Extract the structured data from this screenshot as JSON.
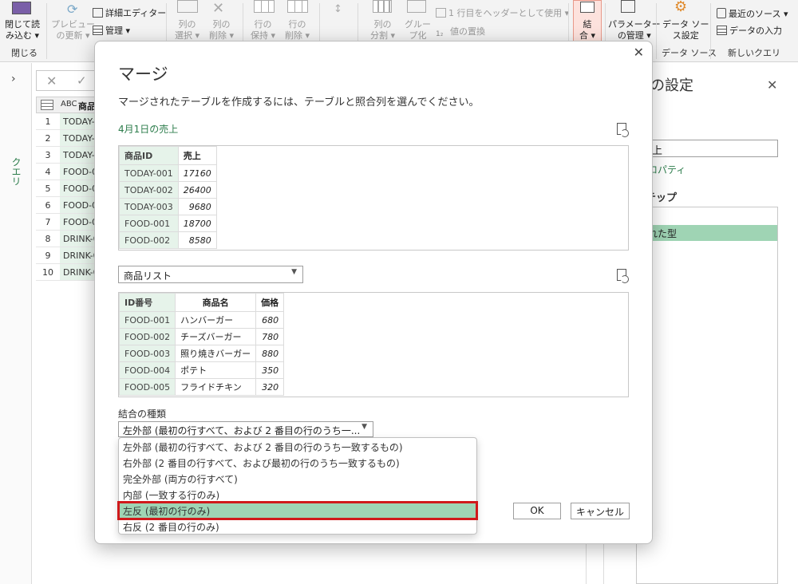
{
  "ribbon": {
    "close_load": [
      "閉じて読",
      "み込む ▾"
    ],
    "close_group": "閉じる",
    "preview_refresh": [
      "プレビュー",
      "の更新 ▾"
    ],
    "advanced_editor": "詳細エディター",
    "manage": "管理 ▾",
    "choose_columns": [
      "列の",
      "選択 ▾"
    ],
    "remove_columns": [
      "列の",
      "削除 ▾"
    ],
    "keep_rows": [
      "行の",
      "保持 ▾"
    ],
    "remove_rows": [
      "行の",
      "削除 ▾"
    ],
    "split_column": [
      "列の",
      "分割 ▾"
    ],
    "group_by": [
      "グルー",
      "プ化"
    ],
    "use_first_row": "1 行目をヘッダーとして使用 ▾",
    "replace_values": "値の置換",
    "merge": [
      "結",
      "合 ▾"
    ],
    "manage_params": [
      "パラメーター",
      "の管理 ▾"
    ],
    "data_source_settings": [
      "データ ソー",
      "ス設定"
    ],
    "data_source_group": "データ ソース",
    "recent_sources": "最近のソース ▾",
    "enter_data": "データの入力",
    "new_query_group": "新しいクエリ"
  },
  "leftpane": {
    "queries_label": "クエリ"
  },
  "grid": {
    "column_header": "商品",
    "type_icon": "ABC",
    "rows": [
      {
        "n": "1",
        "v": "TODAY-0"
      },
      {
        "n": "2",
        "v": "TODAY-0"
      },
      {
        "n": "3",
        "v": "TODAY-0"
      },
      {
        "n": "4",
        "v": "FOOD-0"
      },
      {
        "n": "5",
        "v": "FOOD-0"
      },
      {
        "n": "6",
        "v": "FOOD-0"
      },
      {
        "n": "7",
        "v": "FOOD-0"
      },
      {
        "n": "8",
        "v": "DRINK-0"
      },
      {
        "n": "9",
        "v": "DRINK-0"
      },
      {
        "n": "10",
        "v": "DRINK-0"
      }
    ]
  },
  "rightpane": {
    "title": "の設定",
    "name_value": "売上",
    "all_properties": "ロパティ",
    "applied_steps": "テップ",
    "selected_step": "れた型"
  },
  "dialog": {
    "title": "マージ",
    "description": "マージされたテーブルを作成するには、テーブルと照合列を選んでください。",
    "first_table_name": "4月1日の売上",
    "table1": {
      "headers": [
        "商品ID",
        "売上"
      ],
      "rows": [
        [
          "TODAY-001",
          "17160"
        ],
        [
          "TODAY-002",
          "26400"
        ],
        [
          "TODAY-003",
          "9680"
        ],
        [
          "FOOD-001",
          "18700"
        ],
        [
          "FOOD-002",
          "8580"
        ]
      ]
    },
    "second_table_select": "商品リスト",
    "table2": {
      "headers": [
        "ID番号",
        "商品名",
        "価格"
      ],
      "rows": [
        [
          "FOOD-001",
          "ハンバーガー",
          "680"
        ],
        [
          "FOOD-002",
          "チーズバーガー",
          "780"
        ],
        [
          "FOOD-003",
          "照り焼きバーガー",
          "880"
        ],
        [
          "FOOD-004",
          "ポテト",
          "350"
        ],
        [
          "FOOD-005",
          "フライドチキン",
          "320"
        ]
      ]
    },
    "join_kind_label": "結合の種類",
    "join_kind_selected": "左外部 (最初の行すべて、および 2 番目の行のうち一...",
    "join_options": [
      "左外部 (最初の行すべて、および 2 番目の行のうち一致するもの)",
      "右外部 (2 番目の行すべて、および最初の行のうち一致するもの)",
      "完全外部 (両方の行すべて)",
      "内部 (一致する行のみ)",
      "左反 (最初の行のみ)",
      "右反 (2 番目の行のみ)"
    ],
    "highlighted_option_index": 4,
    "ok_label": "OK",
    "cancel_label": "キャンセル"
  },
  "colors": {
    "accent_green": "#2d7d4c",
    "selection_green": "#9fd4b4",
    "key_column_bg": "#e6f3ea",
    "highlight_border": "#d0191b"
  }
}
